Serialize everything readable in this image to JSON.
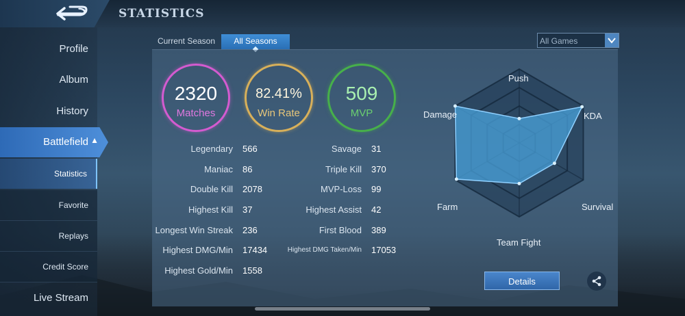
{
  "header": {
    "title": "STATISTICS",
    "back_icon": "back-arrow-icon"
  },
  "sidebar": {
    "items": [
      {
        "label": "Profile"
      },
      {
        "label": "Album"
      },
      {
        "label": "History"
      },
      {
        "label": "Battlefield",
        "active": true
      },
      {
        "label": "Statistics",
        "sub": true,
        "active": true
      },
      {
        "label": "Favorite",
        "sub": true
      },
      {
        "label": "Replays",
        "sub": true
      },
      {
        "label": "Credit Score",
        "sub": true
      },
      {
        "label": "Live Stream"
      }
    ]
  },
  "tabs": {
    "current": "Current Season",
    "all": "All Seasons",
    "selected": "All Seasons"
  },
  "filter": {
    "selected": "All Games"
  },
  "summary": {
    "matches": {
      "value": "2320",
      "label": "Matches",
      "color": "#d45bd0"
    },
    "win_rate": {
      "value": "82.41%",
      "label": "Win Rate",
      "color": "#d8b05a"
    },
    "mvp": {
      "value": "509",
      "label": "MVP",
      "color": "#47b04a"
    }
  },
  "stats_left": [
    {
      "label": "Legendary",
      "value": "566"
    },
    {
      "label": "Maniac",
      "value": "86"
    },
    {
      "label": "Double Kill",
      "value": "2078"
    },
    {
      "label": "Highest Kill",
      "value": "37"
    },
    {
      "label": "Longest Win Streak",
      "value": "236"
    },
    {
      "label": "Highest DMG/Min",
      "value": "17434"
    },
    {
      "label": "Highest Gold/Min",
      "value": "1558"
    }
  ],
  "stats_right": [
    {
      "label": "Savage",
      "value": "31"
    },
    {
      "label": "Triple Kill",
      "value": "370"
    },
    {
      "label": "MVP-Loss",
      "value": "99"
    },
    {
      "label": "Highest Assist",
      "value": "42"
    },
    {
      "label": "First Blood",
      "value": "389"
    },
    {
      "label": "Highest DMG Taken/Min",
      "value": "17053"
    }
  ],
  "radar": {
    "axes": [
      "Push",
      "KDA",
      "Survival",
      "Team Fight",
      "Farm",
      "Damage"
    ],
    "values": [
      0.33,
      0.98,
      0.55,
      0.55,
      0.98,
      1.0
    ],
    "fill_color": "#4aa3dc"
  },
  "actions": {
    "details": "Details",
    "share_icon": "share-icon"
  }
}
